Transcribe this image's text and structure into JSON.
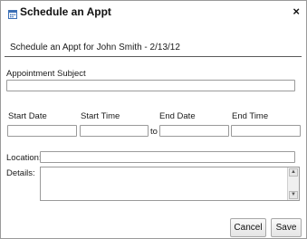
{
  "dialog": {
    "title": "Schedule an Appt",
    "close_label": "×",
    "subheader": "Schedule an Appt for John Smith - 2/13/12"
  },
  "form": {
    "subject_label": "Appointment Subject",
    "subject_value": "",
    "start_date_label": "Start Date",
    "start_date_value": "",
    "start_time_label": "Start Time",
    "start_time_value": "",
    "to_label": "to",
    "end_date_label": "End Date",
    "end_date_value": "",
    "end_time_label": "End Time",
    "end_time_value": "",
    "location_label": "Location:",
    "location_value": "",
    "details_label": "Details:",
    "details_value": ""
  },
  "actions": {
    "cancel_label": "Cancel",
    "save_label": "Save"
  },
  "icons": {
    "title_icon": "calendar-icon",
    "scroll_up": "scroll-up-arrow-icon",
    "scroll_down": "scroll-down-arrow-icon"
  },
  "colors": {
    "border": "#9a9a9a",
    "text": "#1a1a1a",
    "icon_blue": "#3b6fb6"
  }
}
